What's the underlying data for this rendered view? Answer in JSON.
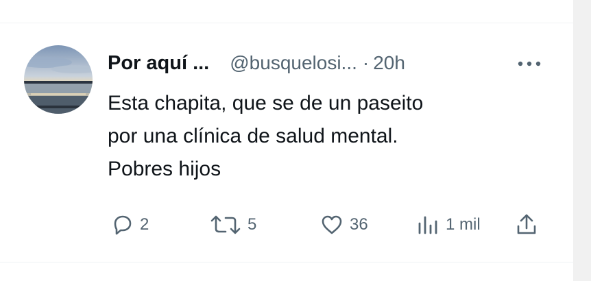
{
  "tweet": {
    "author_name": "Por aquí ...",
    "handle": "@busquelosi...",
    "separator": "·",
    "time": "20h",
    "text_lines": [
      "Esta chapita, que se de un paseito",
      "por una clínica de salud mental.",
      "Pobres hijos"
    ],
    "more_icon": "more-dots-icon"
  },
  "actions": {
    "reply": {
      "icon": "reply-icon",
      "count": "2"
    },
    "retweet": {
      "icon": "retweet-icon",
      "count": "5"
    },
    "like": {
      "icon": "heart-icon",
      "count": "36"
    },
    "views": {
      "icon": "views-bar-icon",
      "count": "1 mil"
    },
    "share": {
      "icon": "share-icon"
    }
  },
  "colors": {
    "text_primary": "#0f1419",
    "text_secondary": "#536471",
    "divider": "#eff3f4"
  }
}
